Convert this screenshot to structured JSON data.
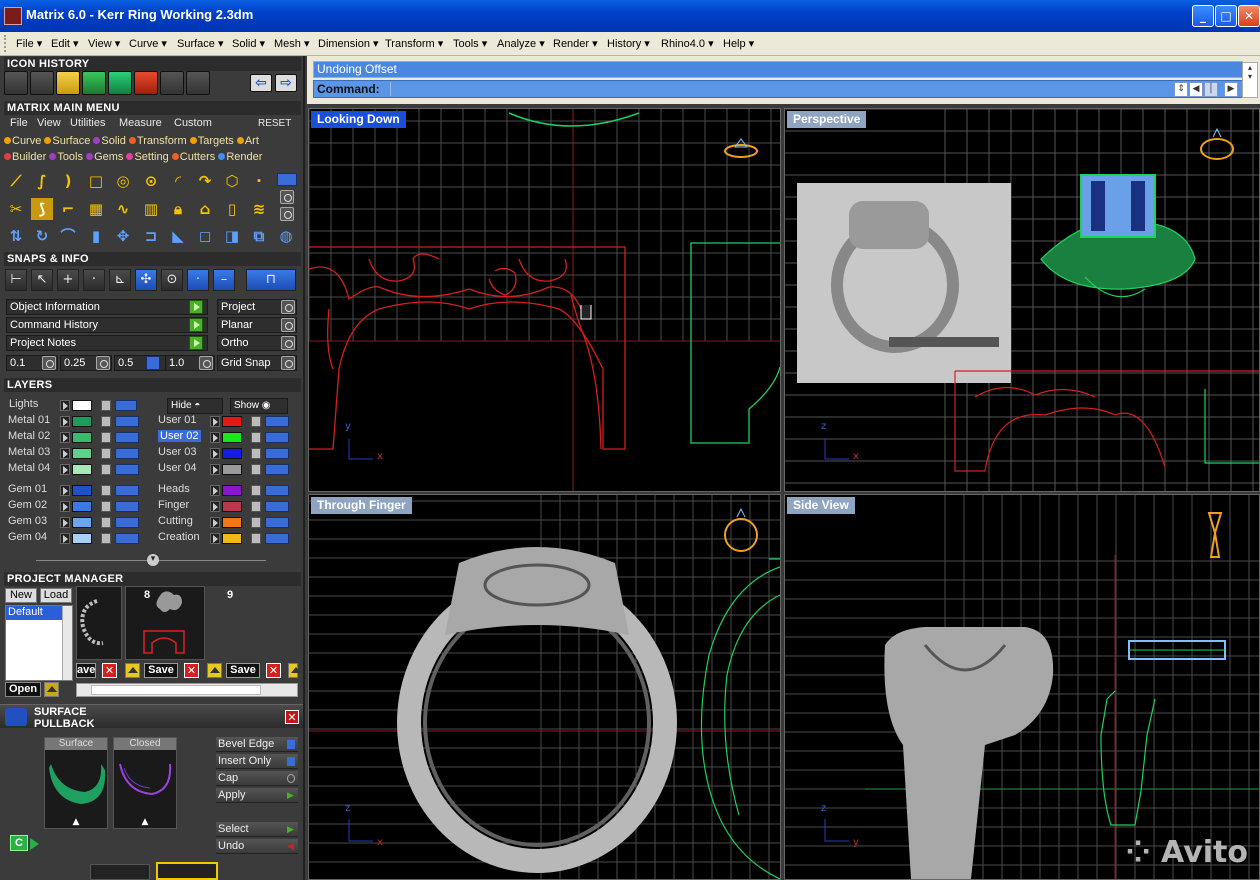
{
  "window": {
    "title": "Matrix 6.0 - Kerr Ring Working 2.3dm",
    "minimize_icon": "minimize-icon",
    "maximize_icon": "maximize-icon",
    "close_icon": "close-icon"
  },
  "menu": [
    "File",
    "Edit",
    "View",
    "Curve",
    "Surface",
    "Solid",
    "Mesh",
    "Dimension",
    "Transform",
    "Tools",
    "Analyze",
    "Render",
    "History",
    "Rhino4.0",
    "Help"
  ],
  "icon_history": {
    "title": "ICON HISTORY"
  },
  "main_menu": {
    "title": "MATRIX MAIN MENU",
    "submenu": [
      "File",
      "View",
      "Utilities",
      "Measure",
      "Custom"
    ],
    "reset": "RESET",
    "modules_row1": [
      "Curve",
      "Surface",
      "Solid",
      "Transform",
      "Targets",
      "Art"
    ],
    "modules_row2": [
      "Builder",
      "Tools",
      "Gems",
      "Setting",
      "Cutters",
      "Render"
    ]
  },
  "snaps": {
    "title": "SNAPS & INFO",
    "left_items": [
      "Object Information",
      "Command History",
      "Project Notes"
    ],
    "right_items": [
      "Project",
      "Planar",
      "Ortho"
    ],
    "increments": [
      "0.1",
      "0.25",
      "0.5",
      "1.0"
    ],
    "grid_snap": "Grid Snap"
  },
  "layers": {
    "title": "LAYERS",
    "lights": "Lights",
    "hide": "Hide",
    "show": "Show",
    "left": [
      {
        "name": "Metal 01",
        "color": "#1e9a5c"
      },
      {
        "name": "Metal 02",
        "color": "#3ab86e"
      },
      {
        "name": "Metal 03",
        "color": "#5fd08a"
      },
      {
        "name": "Metal 04",
        "color": "#a8e8b8"
      },
      {
        "name": "Gem 01",
        "color": "#1a54c8"
      },
      {
        "name": "Gem 02",
        "color": "#3a7ae8"
      },
      {
        "name": "Gem 03",
        "color": "#6aa6f0"
      },
      {
        "name": "Gem 04",
        "color": "#a8cff8"
      }
    ],
    "right": [
      {
        "name": "User 01",
        "color": "#e81818"
      },
      {
        "name": "User 02",
        "color": "#18e818"
      },
      {
        "name": "User 03",
        "color": "#1818e8"
      },
      {
        "name": "User 04",
        "color": "#9a9a9a"
      },
      {
        "name": "Heads",
        "color": "#8a18c8"
      },
      {
        "name": "Finger",
        "color": "#b83a4a"
      },
      {
        "name": "Cutting",
        "color": "#f07818"
      },
      {
        "name": "Creation",
        "color": "#f0b818"
      }
    ]
  },
  "project_manager": {
    "title": "PROJECT MANAGER",
    "new": "New",
    "load": "Load",
    "items": [
      "Default"
    ],
    "slots": [
      "8",
      "9"
    ],
    "save_label": "Save",
    "save_partial": "ave",
    "open": "Open"
  },
  "pullback": {
    "title": "SURFACE PULLBACK",
    "thumb_surface": "Surface",
    "thumb_closed": "Closed",
    "options": [
      "Bevel Edge",
      "Insert Only",
      "Cap",
      "Apply"
    ],
    "select": "Select",
    "undo": "Undo"
  },
  "command": {
    "history": "Undoing Offset",
    "prompt": "Command:"
  },
  "viewports": [
    {
      "name": "Looking Down",
      "active": true
    },
    {
      "name": "Perspective",
      "active": false
    },
    {
      "name": "Through Finger",
      "active": false
    },
    {
      "name": "Side View",
      "active": false
    }
  ],
  "watermark": "Avito",
  "colors": {
    "accent": "#1c4fd8",
    "curve_red": "#d42020",
    "curve_green": "#20d060",
    "grid": "#555555"
  }
}
